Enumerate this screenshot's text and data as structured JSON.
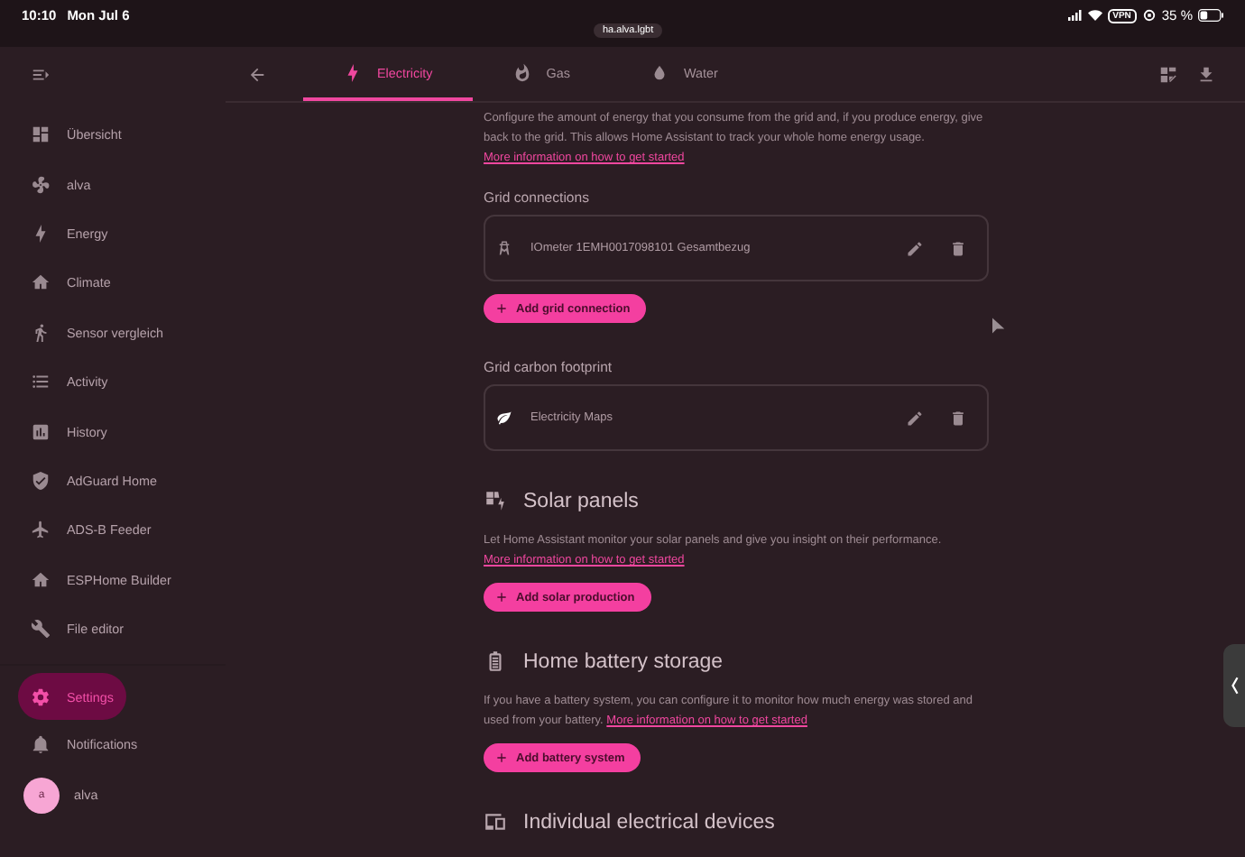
{
  "status_bar": {
    "time": "10:10",
    "date": "Mon Jul 6",
    "vpn": "VPN",
    "battery": "35 %",
    "url": "ha.alva.lgbt"
  },
  "sidebar": {
    "items": [
      {
        "label": "Übersicht",
        "selected": false
      },
      {
        "label": "alva",
        "selected": false
      },
      {
        "label": "Energy",
        "selected": false
      },
      {
        "label": "Climate",
        "selected": false
      },
      {
        "label": "Sensor vergleich",
        "selected": false
      },
      {
        "label": "Activity",
        "selected": false
      },
      {
        "label": "History",
        "selected": false
      },
      {
        "label": "AdGuard Home",
        "selected": false
      },
      {
        "label": "ADS-B Feeder",
        "selected": false
      },
      {
        "label": "ESPHome Builder",
        "selected": false
      },
      {
        "label": "File editor",
        "selected": false
      }
    ],
    "bottom_items": [
      {
        "label": "Settings",
        "selected": true
      },
      {
        "label": "Notifications",
        "selected": false
      }
    ],
    "user": {
      "initial": "a",
      "name": "alva"
    }
  },
  "tabs": [
    {
      "label": "Electricity",
      "selected": true
    },
    {
      "label": "Gas",
      "selected": false
    },
    {
      "label": "Water",
      "selected": false
    }
  ],
  "grid": {
    "description": "Configure the amount of energy that you consume from the grid and, if you produce energy, give back to the grid. This allows Home Assistant to track your whole home energy usage.",
    "link": "More information on how to get started",
    "connections_title": "Grid connections",
    "connections": [
      {
        "label": "IOmeter 1EMH0017098101 Gesamtbezug"
      }
    ],
    "add_button": "Add grid connection",
    "carbon_title": "Grid carbon footprint",
    "carbon": [
      {
        "label": "Electricity Maps"
      }
    ]
  },
  "solar": {
    "title": "Solar panels",
    "description": "Let Home Assistant monitor your solar panels and give you insight on their performance.",
    "link": "More information on how to get started",
    "add_button": "Add solar production"
  },
  "battery": {
    "title": "Home battery storage",
    "description": "If you have a battery system, you can configure it to monitor how much energy was stored and used from your battery.",
    "link": "More information on how to get started",
    "add_button": "Add battery system"
  },
  "devices": {
    "title": "Individual electrical devices"
  }
}
